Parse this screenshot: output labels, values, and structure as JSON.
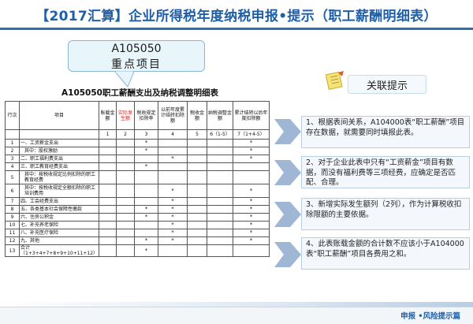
{
  "title": "【2017汇算】企业所得税年度纳税申报•提示（职工薪酬明细表）",
  "callout": {
    "code": "A105050",
    "label": "重点项目"
  },
  "table": {
    "title": "A105050职工薪酬支出及纳税调整明细表",
    "headers": {
      "row_no": "行次",
      "item": "项目",
      "col1": "账载金额",
      "col2": "实际发生额",
      "col3": "税收规定扣除率",
      "col4": "以前年度累计结转扣除额",
      "col5": "税收金额",
      "col6": "纳税调整金额",
      "col7": "累计结转以后年度扣除额"
    },
    "col_numbers": [
      "1",
      "2",
      "3",
      "4",
      "5",
      "6（1-5）",
      "7（1+4-5）"
    ],
    "rows": [
      {
        "n": "1",
        "item": "一、工资薪金支出",
        "marks": [
          "",
          "",
          "*",
          "",
          "",
          "",
          "*"
        ]
      },
      {
        "n": "2",
        "item": "其中：股权激励",
        "marks": [
          "",
          "",
          "*",
          "",
          "",
          "",
          "*"
        ]
      },
      {
        "n": "3",
        "item": "二、职工福利费支出",
        "marks": [
          "",
          "",
          "",
          "*",
          "",
          "",
          "*"
        ]
      },
      {
        "n": "4",
        "item": "三、职工教育经费支出",
        "marks": [
          "",
          "",
          "*",
          "",
          "",
          "",
          ""
        ]
      },
      {
        "n": "5",
        "item": "其中：按税收规定比例扣除的职工教育经费",
        "marks": [
          "",
          "",
          "",
          "",
          "",
          "",
          ""
        ]
      },
      {
        "n": "6",
        "item": "其中：按税收规定全额扣除的职工培训费用",
        "marks": [
          "",
          "",
          "",
          "*",
          "",
          "",
          "*"
        ]
      },
      {
        "n": "7",
        "item": "四、工会经费支出",
        "marks": [
          "",
          "",
          "",
          "*",
          "",
          "",
          "*"
        ]
      },
      {
        "n": "8",
        "item": "五、各类基本社会保障性缴款",
        "marks": [
          "",
          "",
          "*",
          "*",
          "",
          "",
          "*"
        ]
      },
      {
        "n": "9",
        "item": "六、住房公积金",
        "marks": [
          "",
          "",
          "*",
          "*",
          "",
          "",
          "*"
        ]
      },
      {
        "n": "10",
        "item": "七、补充养老保险",
        "marks": [
          "",
          "",
          "",
          "*",
          "",
          "",
          "*"
        ]
      },
      {
        "n": "11",
        "item": "八、补充医疗保险",
        "marks": [
          "",
          "",
          "",
          "*",
          "",
          "",
          "*"
        ]
      },
      {
        "n": "12",
        "item": "九、其他",
        "marks": [
          "",
          "",
          "*",
          "*",
          "",
          "",
          "*"
        ]
      },
      {
        "n": "13",
        "item": "合计（1+3+4+7+8+9+10+11+12）",
        "marks": [
          "",
          "",
          "*",
          "",
          "",
          "",
          ""
        ]
      }
    ]
  },
  "hints": {
    "heading": "关联提示",
    "items": [
      "1、根据表间关系，A104000表“职工薪酬”项目存在数据，就需要同时填报此表。",
      "2、对于企业此表中只有“工资薪金”项目有数据，而没有福利费等三项经费，应确定是否匹配、合理。",
      "3、新增实际发生额列（2列），作为计算税收扣除限额的主要依据。",
      "4、此表账载金额的合计数不应该小于A104000表“职工薪酬”项目各费用之和。"
    ]
  },
  "footer": "申报 •风险提示篇"
}
